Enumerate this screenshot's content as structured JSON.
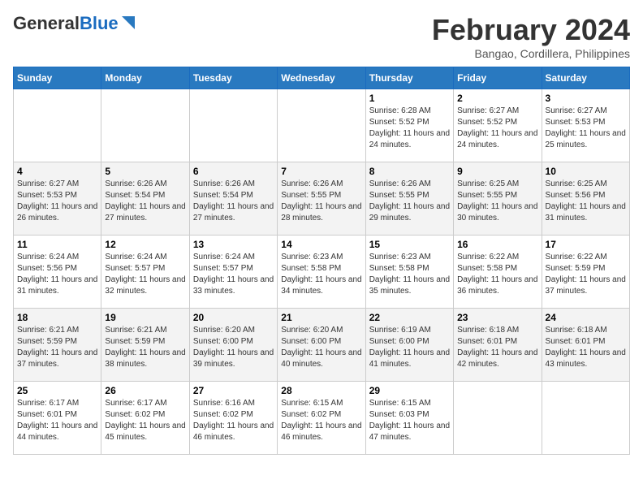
{
  "header": {
    "logo_general": "General",
    "logo_blue": "Blue",
    "month_year": "February 2024",
    "location": "Bangao, Cordillera, Philippines"
  },
  "weekdays": [
    "Sunday",
    "Monday",
    "Tuesday",
    "Wednesday",
    "Thursday",
    "Friday",
    "Saturday"
  ],
  "weeks": [
    [
      {
        "day": "",
        "info": ""
      },
      {
        "day": "",
        "info": ""
      },
      {
        "day": "",
        "info": ""
      },
      {
        "day": "",
        "info": ""
      },
      {
        "day": "1",
        "info": "Sunrise: 6:28 AM\nSunset: 5:52 PM\nDaylight: 11 hours and 24 minutes."
      },
      {
        "day": "2",
        "info": "Sunrise: 6:27 AM\nSunset: 5:52 PM\nDaylight: 11 hours and 24 minutes."
      },
      {
        "day": "3",
        "info": "Sunrise: 6:27 AM\nSunset: 5:53 PM\nDaylight: 11 hours and 25 minutes."
      }
    ],
    [
      {
        "day": "4",
        "info": "Sunrise: 6:27 AM\nSunset: 5:53 PM\nDaylight: 11 hours and 26 minutes."
      },
      {
        "day": "5",
        "info": "Sunrise: 6:26 AM\nSunset: 5:54 PM\nDaylight: 11 hours and 27 minutes."
      },
      {
        "day": "6",
        "info": "Sunrise: 6:26 AM\nSunset: 5:54 PM\nDaylight: 11 hours and 27 minutes."
      },
      {
        "day": "7",
        "info": "Sunrise: 6:26 AM\nSunset: 5:55 PM\nDaylight: 11 hours and 28 minutes."
      },
      {
        "day": "8",
        "info": "Sunrise: 6:26 AM\nSunset: 5:55 PM\nDaylight: 11 hours and 29 minutes."
      },
      {
        "day": "9",
        "info": "Sunrise: 6:25 AM\nSunset: 5:55 PM\nDaylight: 11 hours and 30 minutes."
      },
      {
        "day": "10",
        "info": "Sunrise: 6:25 AM\nSunset: 5:56 PM\nDaylight: 11 hours and 31 minutes."
      }
    ],
    [
      {
        "day": "11",
        "info": "Sunrise: 6:24 AM\nSunset: 5:56 PM\nDaylight: 11 hours and 31 minutes."
      },
      {
        "day": "12",
        "info": "Sunrise: 6:24 AM\nSunset: 5:57 PM\nDaylight: 11 hours and 32 minutes."
      },
      {
        "day": "13",
        "info": "Sunrise: 6:24 AM\nSunset: 5:57 PM\nDaylight: 11 hours and 33 minutes."
      },
      {
        "day": "14",
        "info": "Sunrise: 6:23 AM\nSunset: 5:58 PM\nDaylight: 11 hours and 34 minutes."
      },
      {
        "day": "15",
        "info": "Sunrise: 6:23 AM\nSunset: 5:58 PM\nDaylight: 11 hours and 35 minutes."
      },
      {
        "day": "16",
        "info": "Sunrise: 6:22 AM\nSunset: 5:58 PM\nDaylight: 11 hours and 36 minutes."
      },
      {
        "day": "17",
        "info": "Sunrise: 6:22 AM\nSunset: 5:59 PM\nDaylight: 11 hours and 37 minutes."
      }
    ],
    [
      {
        "day": "18",
        "info": "Sunrise: 6:21 AM\nSunset: 5:59 PM\nDaylight: 11 hours and 37 minutes."
      },
      {
        "day": "19",
        "info": "Sunrise: 6:21 AM\nSunset: 5:59 PM\nDaylight: 11 hours and 38 minutes."
      },
      {
        "day": "20",
        "info": "Sunrise: 6:20 AM\nSunset: 6:00 PM\nDaylight: 11 hours and 39 minutes."
      },
      {
        "day": "21",
        "info": "Sunrise: 6:20 AM\nSunset: 6:00 PM\nDaylight: 11 hours and 40 minutes."
      },
      {
        "day": "22",
        "info": "Sunrise: 6:19 AM\nSunset: 6:00 PM\nDaylight: 11 hours and 41 minutes."
      },
      {
        "day": "23",
        "info": "Sunrise: 6:18 AM\nSunset: 6:01 PM\nDaylight: 11 hours and 42 minutes."
      },
      {
        "day": "24",
        "info": "Sunrise: 6:18 AM\nSunset: 6:01 PM\nDaylight: 11 hours and 43 minutes."
      }
    ],
    [
      {
        "day": "25",
        "info": "Sunrise: 6:17 AM\nSunset: 6:01 PM\nDaylight: 11 hours and 44 minutes."
      },
      {
        "day": "26",
        "info": "Sunrise: 6:17 AM\nSunset: 6:02 PM\nDaylight: 11 hours and 45 minutes."
      },
      {
        "day": "27",
        "info": "Sunrise: 6:16 AM\nSunset: 6:02 PM\nDaylight: 11 hours and 46 minutes."
      },
      {
        "day": "28",
        "info": "Sunrise: 6:15 AM\nSunset: 6:02 PM\nDaylight: 11 hours and 46 minutes."
      },
      {
        "day": "29",
        "info": "Sunrise: 6:15 AM\nSunset: 6:03 PM\nDaylight: 11 hours and 47 minutes."
      },
      {
        "day": "",
        "info": ""
      },
      {
        "day": "",
        "info": ""
      }
    ]
  ]
}
